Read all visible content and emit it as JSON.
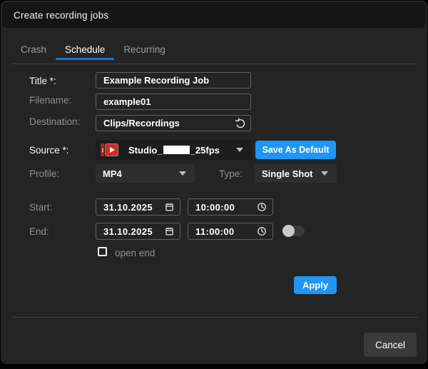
{
  "window": {
    "title": "Create recording jobs"
  },
  "tabs": {
    "crash": "Crash",
    "schedule": "Schedule",
    "recurring": "Recurring",
    "active_tab": "Schedule"
  },
  "fields": {
    "title": {
      "label": "Title *:",
      "value": "Example Recording Job"
    },
    "filename": {
      "label": "Filename:",
      "value": "example01"
    },
    "destination": {
      "label": "Destination:",
      "value": "Clips/Recordings"
    },
    "source": {
      "label": "Source *:",
      "value_prefix": "Studio_",
      "value_suffix": "_25fps",
      "redacted": true
    },
    "profile": {
      "label": "Profile:",
      "value": "MP4"
    },
    "type": {
      "label": "Type:",
      "value": "Single Shot"
    },
    "start": {
      "label": "Start:",
      "date": "31.10.2025",
      "time": "10:00:00"
    },
    "end": {
      "label": "End:",
      "date": "31.10.2025",
      "time": "11:00:00",
      "toggle_on": false
    },
    "open_end": {
      "label": "open end",
      "checked": false
    }
  },
  "buttons": {
    "save_as_default": "Save As Default",
    "apply": "Apply",
    "cancel": "Cancel"
  },
  "colors": {
    "accent_blue": "#2095f3",
    "tab_underline": "#1576d2",
    "dialog_bg": "#242424",
    "titlebar_bg": "#151515"
  }
}
